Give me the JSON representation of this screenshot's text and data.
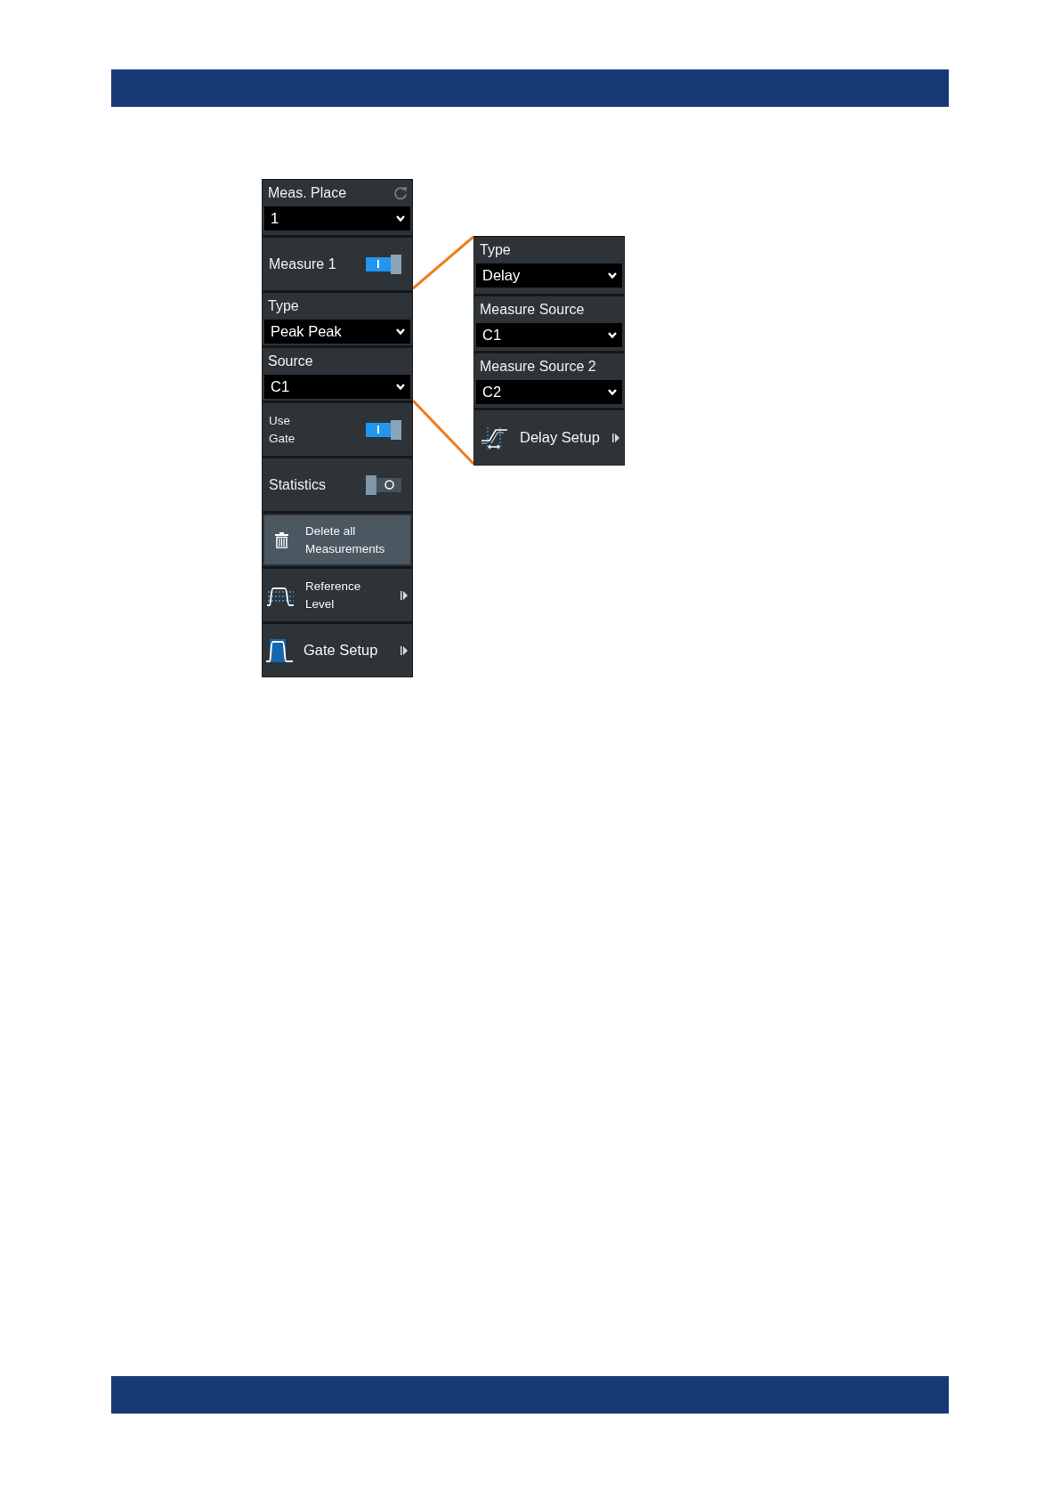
{
  "left_panel": {
    "items": [
      {
        "kind": "dropdown",
        "label": "Meas. Place",
        "value": "1",
        "resettable": true
      },
      {
        "kind": "switch",
        "label": "Measure 1",
        "on": true,
        "compact": false
      },
      {
        "kind": "dropdown",
        "label": "Type",
        "value": "Peak Peak",
        "resettable": false
      },
      {
        "kind": "dropdown",
        "label": "Source",
        "value": "C1",
        "resettable": false
      },
      {
        "kind": "switch",
        "label": "Use Gate",
        "on": true,
        "compact": true
      },
      {
        "kind": "switch",
        "label": "Statistics",
        "on": false,
        "compact": false
      },
      {
        "kind": "button",
        "label": "Delete all Measurements",
        "compact": true
      },
      {
        "kind": "submenu",
        "label": "Reference Level",
        "compact": true
      },
      {
        "kind": "submenu",
        "label": "Gate Setup",
        "compact": false
      }
    ]
  },
  "right_panel": {
    "items": [
      {
        "kind": "dropdown",
        "label": "Type",
        "value": "Delay",
        "resettable": false
      },
      {
        "kind": "dropdown",
        "label": "Measure Source",
        "value": "C1",
        "resettable": false
      },
      {
        "kind": "dropdown",
        "label": "Measure Source 2",
        "value": "C2",
        "resettable": false
      },
      {
        "kind": "submenu",
        "label": "Delay Setup",
        "compact": false
      }
    ]
  }
}
